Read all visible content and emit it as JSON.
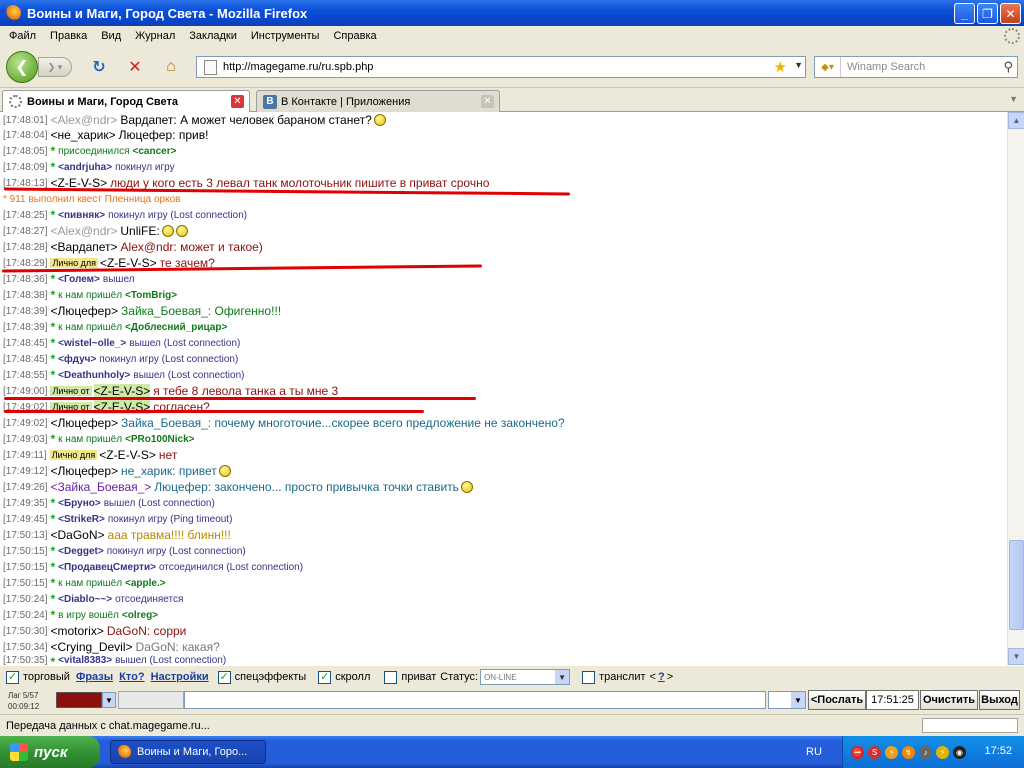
{
  "window": {
    "title": "Воины и Маги, Город Света - Mozilla Firefox"
  },
  "menu": [
    "Файл",
    "Правка",
    "Вид",
    "Журнал",
    "Закладки",
    "Инструменты",
    "Справка"
  ],
  "address": {
    "url": "http://magegame.ru/ru.spb.php"
  },
  "search": {
    "placeholder": "Winamp Search"
  },
  "tabs": [
    {
      "label": "Воины и Маги, Город Света"
    },
    {
      "label": "В Контакте | Приложения"
    }
  ],
  "chat": {
    "l0": {
      "time": "[17:48:01]",
      "nick": "<Alex@ndr>",
      "text": "Вардапет: А может человек бараном станет?"
    },
    "l1": {
      "time": "[17:48:04]",
      "nick": "<не_харик>",
      "text": "Люцефер: прив!"
    },
    "l2": {
      "time": "[17:48:05]",
      "pre": "присоединился",
      "nick": "<cancer>"
    },
    "l3": {
      "time": "[17:48:09]",
      "nick": "<andrjuha>",
      "post": "покинул игру"
    },
    "l4": {
      "time": "[17:48:13]",
      "nick": "<Z-E-V-S>",
      "text": "люди у кого есть 3 левал танк молоточьник пишите в приват срочно"
    },
    "l5": {
      "text": "* 911 выполнил квест Пленница орков"
    },
    "l6": {
      "time": "[17:48:25]",
      "nick": "<пивняк>",
      "post": "покинул игру (Lost connection)"
    },
    "l7": {
      "time": "[17:48:27]",
      "nick": "<Alex@ndr>",
      "text": "UnliFE:"
    },
    "l8": {
      "time": "[17:48:28]",
      "nick": "<Вардапет>",
      "text": "Alex@ndr: может и такое)"
    },
    "l9": {
      "time": "[17:48:29]",
      "tag": "Лично для",
      "nick": "<Z-E-V-S>",
      "text": "те зачем?"
    },
    "l10": {
      "time": "[17:48:36]",
      "nick": "<Голем>",
      "post": "вышел"
    },
    "l11": {
      "time": "[17:48:38]",
      "pre": "к нам пришёл",
      "nick": "<TomBrig>"
    },
    "l12": {
      "time": "[17:48:39]",
      "nick": "<Люцефер>",
      "text": "Зайка_Боевая_: Офигенно!!!"
    },
    "l13": {
      "time": "[17:48:39]",
      "pre": "к нам пришёл",
      "nick": "<Доблесний_рицар>"
    },
    "l14": {
      "time": "[17:48:45]",
      "nick": "<wistel~olle_>",
      "post": "вышел (Lost connection)"
    },
    "l15": {
      "time": "[17:48:45]",
      "nick": "<фдуч>",
      "post": "покинул игру (Lost connection)"
    },
    "l16": {
      "time": "[17:48:55]",
      "nick": "<Deathunholy>",
      "post": "вышел (Lost connection)"
    },
    "l17": {
      "time": "[17:49:00]",
      "tag": "Лично от",
      "nick": "<Z-E-V-S>",
      "text": "я тебе 8 левола танка а ты мне 3"
    },
    "l18": {
      "time": "[17:49:02]",
      "tag": "Лично от",
      "nick": "<Z-E-V-S>",
      "text": "согласен?"
    },
    "l19": {
      "time": "[17:49:02]",
      "nick": "<Люцефер>",
      "text": "Зайка_Боевая_: почему многоточие...скорее всего предложение не закончено?"
    },
    "l20": {
      "time": "[17:49:03]",
      "pre": "к нам пришёл",
      "nick": "<PRo100Nick>"
    },
    "l21": {
      "time": "[17:49:11]",
      "tag": "Лично для",
      "nick": "<Z-E-V-S>",
      "text": "нет"
    },
    "l22": {
      "time": "[17:49:12]",
      "nick": "<Люцефер>",
      "text": "не_харик: привет"
    },
    "l23": {
      "time": "[17:49:26]",
      "nick": "<Зайка_Боевая_>",
      "text": "Люцефер: закончено... просто привычка точки ставить"
    },
    "l24": {
      "time": "[17:49:35]",
      "nick": "<Бруно>",
      "post": "вышел (Lost connection)"
    },
    "l25": {
      "time": "[17:49:45]",
      "nick": "<StrikeR>",
      "post": "покинул игру (Ping timeout)"
    },
    "l26": {
      "time": "[17:50:13]",
      "nick": "<DaGoN>",
      "text": "ааа травма!!!! блинн!!!"
    },
    "l27": {
      "time": "[17:50:15]",
      "nick": "<Degget>",
      "post": "покинул игру (Lost connection)"
    },
    "l28": {
      "time": "[17:50:15]",
      "nick": "<ПродавецСмерти>",
      "post": "отсоединился (Lost connection)"
    },
    "l29": {
      "time": "[17:50:15]",
      "pre": "к нам пришёл",
      "nick": "<apple.>"
    },
    "l30": {
      "time": "[17:50:24]",
      "nick": "<Diablo~~>",
      "post": "отсоединяется"
    },
    "l31": {
      "time": "[17:50:24]",
      "pre": "в игру вошёл",
      "nick": "<olreg>"
    },
    "l32": {
      "time": "[17:50:30]",
      "nick": "<motorix>",
      "text": "DaGoN: сорри"
    },
    "l33": {
      "time": "[17:50:34]",
      "nick": "<Crying_Devil>",
      "text": "DaGoN: какая?"
    },
    "l34": {
      "time": "[17:50:35]",
      "nick": "<vital8383>",
      "post": "вышел (Lost connection)"
    }
  },
  "options": {
    "torg": "торговый",
    "phrases": "Фразы",
    "who": "Кто?",
    "settings": "Настройки",
    "effects": "спецэффекты",
    "scroll": "скролл",
    "private": "приват",
    "status_label": "Статус:",
    "status_value": "ON-LINE",
    "translit": "транслит",
    "translit_lt": "<",
    "translit_q": "?",
    "translit_gt": ">"
  },
  "input": {
    "lag": "Лаг 5/57",
    "timer": "00:09:12",
    "send": "<Послать",
    "clock": "17:51:25",
    "clear": "Очистить",
    "exit": "Выход"
  },
  "statusbar": {
    "text": "Передача данных с chat.magegame.ru..."
  },
  "taskbar": {
    "start": "пуск",
    "item": "Воины и Маги, Горо...",
    "lang": "RU",
    "time": "17:52"
  },
  "colors": {
    "accent_red": "#e00000",
    "title_blue": "#0b4fd8",
    "sys_green": "#0d7a1a",
    "nick_color": "#8b0f0f"
  }
}
